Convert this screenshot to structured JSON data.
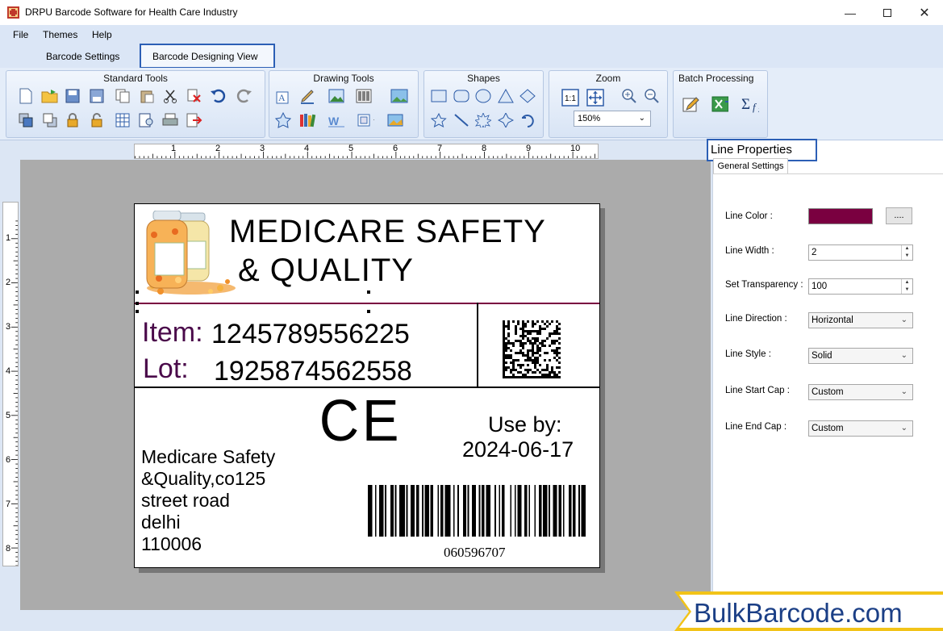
{
  "window": {
    "title": "DRPU Barcode Software for Health Care Industry"
  },
  "menu": [
    "File",
    "Themes",
    "Help"
  ],
  "tabs": [
    "Barcode Settings",
    "Barcode Designing View"
  ],
  "ribbon": {
    "standard_tools": "Standard Tools",
    "drawing_tools": "Drawing Tools",
    "shapes": "Shapes",
    "zoom": "Zoom",
    "zoom_value": "150%",
    "batch_processing": "Batch Processing"
  },
  "ruler": {
    "h": [
      "1",
      "2",
      "3",
      "4",
      "5",
      "6",
      "7",
      "8",
      "9",
      "10"
    ],
    "v": [
      "1",
      "2",
      "3",
      "4",
      "5",
      "6",
      "7",
      "8"
    ]
  },
  "label": {
    "title_line1": "MEDICARE SAFETY",
    "title_line2": "& QUALITY",
    "item_label": "Item:",
    "item_value": "1245789556225",
    "lot_label": "Lot:",
    "lot_value": "1925874562558",
    "ce_mark": "CE",
    "use_by_label": "Use by:",
    "use_by_date": "2024-06-17",
    "address": [
      "Medicare Safety",
      "&Quality,co125",
      "street road",
      "delhi",
      "110006"
    ],
    "barcode_number": "060596707"
  },
  "properties": {
    "title": "Line Properties",
    "tab": "General Settings",
    "line_color_label": "Line Color :",
    "line_color": "#7a0040",
    "color_button": "....",
    "line_width_label": "Line Width :",
    "line_width": "2",
    "transparency_label": "Set Transparency :",
    "transparency": "100",
    "direction_label": "Line Direction :",
    "direction": "Horizontal",
    "style_label": "Line Style :",
    "style": "Solid",
    "start_cap_label": "Line Start Cap :",
    "start_cap": "Custom",
    "end_cap_label": "Line End Cap :",
    "end_cap": "Custom"
  },
  "watermark": "BulkBarcode.com",
  "colors": {
    "accent": "#2c5fb5",
    "label_purple": "#4a0a4a",
    "ribbon": "#e4edf9"
  }
}
